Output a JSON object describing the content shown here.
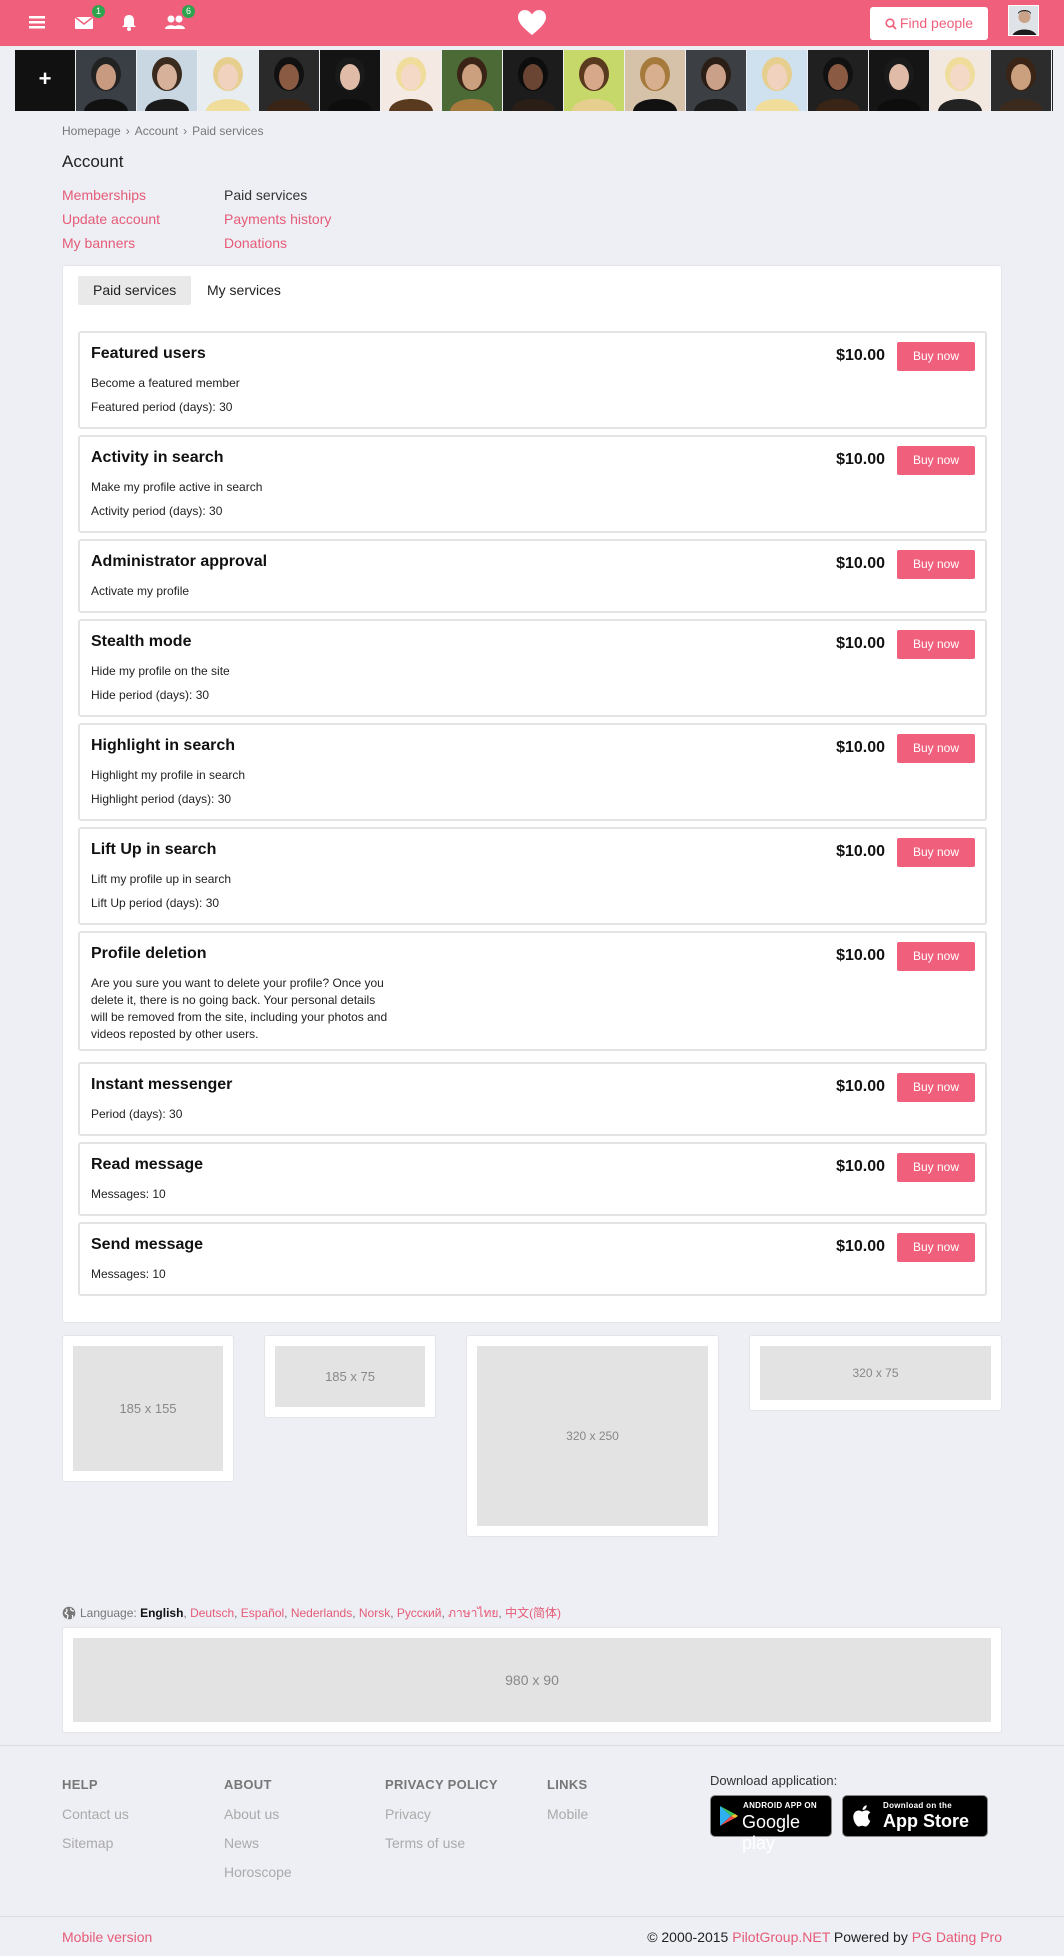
{
  "topbar": {
    "message_badge": "1",
    "friends_badge": "6",
    "find_people_label": "Find people"
  },
  "colors": {
    "brand": "#f0607c",
    "link": "#e55b77",
    "badge": "#2fa44f"
  },
  "icons": {
    "menu": "hamburger-icon",
    "messages": "envelope-icon",
    "notifications": "bell-icon",
    "friends": "users-icon",
    "logo": "heart-icon",
    "search": "search-icon",
    "language": "globe-icon"
  },
  "breadcrumb": [
    "Homepage",
    "Account",
    "Paid services"
  ],
  "page_title": "Account",
  "account_links": {
    "memberships": "Memberships",
    "update_account": "Update account",
    "my_banners": "My banners",
    "paid_services": "Paid services",
    "payments_history": "Payments history",
    "donations": "Donations"
  },
  "tabs": {
    "paid_services": "Paid services",
    "my_services": "My services"
  },
  "buy_label": "Buy now",
  "services": [
    {
      "name": "Featured users",
      "price": "$10.00",
      "lines": [
        "Become a featured member",
        "Featured period (days): 30"
      ]
    },
    {
      "name": "Activity in search",
      "price": "$10.00",
      "lines": [
        "Make my profile active in search",
        "Activity period (days): 30"
      ]
    },
    {
      "name": "Administrator approval",
      "price": "$10.00",
      "lines": [
        "Activate my profile"
      ]
    },
    {
      "name": "Stealth mode",
      "price": "$10.00",
      "lines": [
        "Hide my profile on the site",
        "Hide period (days): 30"
      ]
    },
    {
      "name": "Highlight in search",
      "price": "$10.00",
      "lines": [
        "Highlight my profile in search",
        "Highlight period (days): 30"
      ]
    },
    {
      "name": "Lift Up in search",
      "price": "$10.00",
      "lines": [
        "Lift my profile up in search",
        "Lift Up period (days): 30"
      ]
    },
    {
      "name": "Profile deletion",
      "price": "$10.00",
      "lines": [
        "Are you sure you want to delete your profile? Once you delete it, there is no going back. Your personal details will be removed from the site, including your photos and videos reposted by other users."
      ]
    },
    {
      "name": "Instant messenger",
      "price": "$10.00",
      "lines": [
        "Period (days): 30"
      ]
    },
    {
      "name": "Read message",
      "price": "$10.00",
      "lines": [
        "Messages: 10"
      ]
    },
    {
      "name": "Send message",
      "price": "$10.00",
      "lines": [
        "Messages: 10"
      ]
    }
  ],
  "banners": {
    "b1": "185 x 155",
    "b2": "185 x 75",
    "b3": "320 x 250",
    "b4": "320 x 75",
    "bottom": "980 x 90"
  },
  "language": {
    "label": "Language:",
    "current": "English",
    "others": [
      "Deutsch",
      "Español",
      "Nederlands",
      "Norsk",
      "Русский",
      "ภาษาไทย",
      "中文(简体)"
    ]
  },
  "footer": {
    "help": {
      "title": "HELP",
      "links": [
        "Contact us",
        "Sitemap"
      ]
    },
    "about": {
      "title": "ABOUT",
      "links": [
        "About us",
        "News",
        "Horoscope"
      ]
    },
    "privacy": {
      "title": "PRIVACY POLICY",
      "links": [
        "Privacy",
        "Terms of use"
      ]
    },
    "links": {
      "title": "LINKS",
      "links": [
        "Mobile"
      ]
    },
    "download_label": "Download application:",
    "google_play": {
      "small": "ANDROID APP ON",
      "big": "Google play"
    },
    "app_store": {
      "small": "Download on the",
      "big": "App Store"
    },
    "mobile_version": "Mobile version",
    "copyright_prefix": "© 2000-2015",
    "company": "PilotGroup.NET",
    "powered_by": "Powered by",
    "product": "PG Dating Pro"
  },
  "strip_photo_count": 17
}
